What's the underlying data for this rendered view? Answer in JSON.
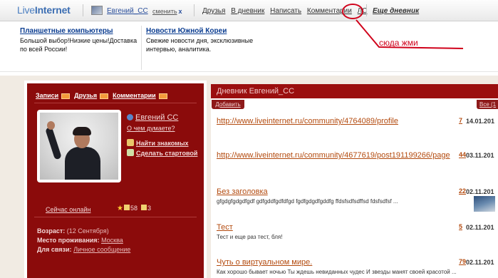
{
  "topbar": {
    "logo_light": "Live",
    "logo_bold": "Internet",
    "user_name": "Евгений_СС",
    "change_label": "сменить",
    "change_x": "x",
    "nav": [
      "Друзья",
      "В дневник",
      "Написать",
      "Комментарии",
      "ЛС"
    ],
    "more_diary": "Еще дневник"
  },
  "annotation": {
    "text": "сюда жми",
    "color": "#d0021b"
  },
  "ads": [
    {
      "title": "Планшетные компьютеры",
      "text_line1": "Большой выбор!Низкие цены!Доставка",
      "text_line2": "по всей России!"
    },
    {
      "title": "Новости Южной Кореи",
      "text_line1": "Свежие новости дня, эксклюзивные",
      "text_line2": "интервью, аналитика."
    }
  ],
  "profile": {
    "tabs": [
      "Записи",
      "Друзья",
      "Комментарии"
    ],
    "name": "Евгений СС",
    "thinking": "О чем думаете?",
    "actions": [
      "Найти знакомых",
      "Сделать стартовой"
    ],
    "online": "Сейчас онлайн",
    "count1": "58",
    "count2": "3",
    "age_label": "Возраст:",
    "age_value": "(12 Сентября)",
    "place_label": "Место проживания:",
    "place_value": "Москва",
    "contact_label": "Для связи:",
    "contact_value": "Личное сообщение"
  },
  "diary": {
    "title": "Дневник Евгений_СС",
    "add_button": "Добавить",
    "all_button": "Все (1",
    "posts": [
      {
        "title": "http://www.liveinternet.ru/community/4764089/profile",
        "count": "7",
        "date": "14.01.201",
        "text": ""
      },
      {
        "title": "http://www.liveinternet.ru/community/4677619/post191199266/page",
        "count": "44",
        "date": "03.11.201",
        "text": ""
      },
      {
        "title": "Без заголовка",
        "count": "22",
        "date": "02.11.201",
        "text": "gfgdgfgdgdfgdf gdfgddfgdfdfgd fgdfgdgdfgddfg ffdsfsdfsdffsd fdsfsdfsf ..."
      },
      {
        "title": "Тест",
        "count": "5",
        "date": "02.11.201",
        "text": "Тест и еще раз тест, бля!"
      },
      {
        "title": "Чуть о виртуальном мире.",
        "count": "79",
        "date": "02.11.201",
        "text": "Как хорошо бывает ночью Ты ждешь невиданных чудес И звезды манят своей красотой ..."
      }
    ]
  }
}
